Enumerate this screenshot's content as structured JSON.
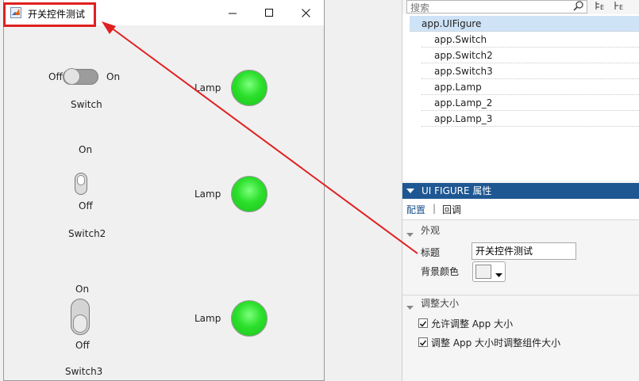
{
  "window": {
    "title": "开关控件测试",
    "controls": [
      "minimize",
      "maximize",
      "close"
    ]
  },
  "switches": {
    "switch1": {
      "off_label": "Off",
      "on_label": "On",
      "name": "Switch",
      "state": "Off"
    },
    "switch2": {
      "on_label": "On",
      "off_label": "Off",
      "name": "Switch2",
      "state": "Off"
    },
    "switch3": {
      "on_label": "On",
      "off_label": "Off",
      "name": "Switch3",
      "state": "Off"
    }
  },
  "lamps": [
    {
      "label": "Lamp",
      "color": "#22dd22"
    },
    {
      "label": "Lamp",
      "color": "#22dd22"
    },
    {
      "label": "Lamp",
      "color": "#22dd22"
    }
  ],
  "designer": {
    "search": {
      "placeholder": "搜索"
    },
    "tree": {
      "root": "app.UIFigure",
      "children": [
        "app.Switch",
        "app.Switch2",
        "app.Switch3",
        "app.Lamp",
        "app.Lamp_2",
        "app.Lamp_3"
      ]
    },
    "properties": {
      "header": "UI FIGURE 属性",
      "tabs": {
        "config": "配置",
        "separator": "|",
        "callback": "回调"
      },
      "appearance": {
        "section": "外观",
        "title_label": "标题",
        "title_value": "开关控件测试",
        "bgcolor_label": "背景颜色",
        "bgcolor_value": "#f0f0f0"
      },
      "resize": {
        "section": "调整大小",
        "allow_resize": {
          "label": "允许调整 App 大小",
          "checked": true
        },
        "resize_children": {
          "label": "调整 App 大小时调整组件大小",
          "checked": true
        }
      }
    }
  },
  "annotation": {
    "color": "#e02020"
  }
}
